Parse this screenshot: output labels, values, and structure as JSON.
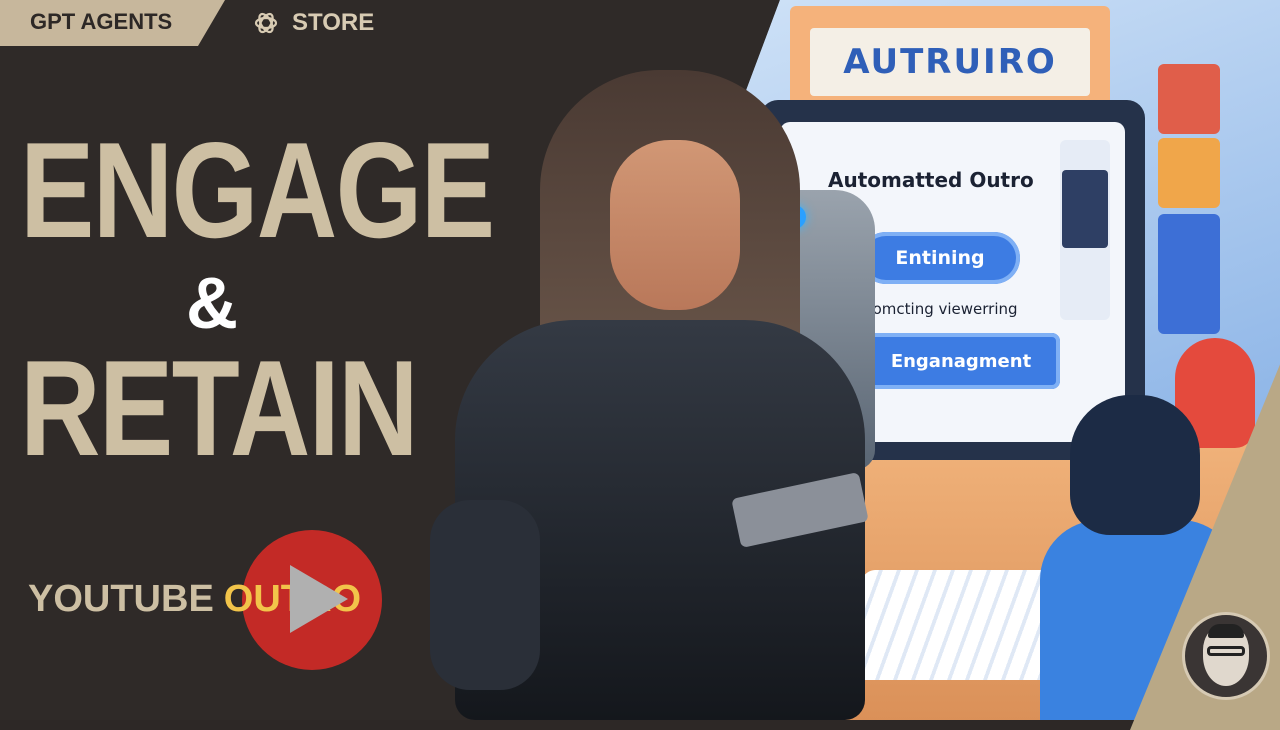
{
  "header": {
    "gpt_agents_label": "GPT AGENTS",
    "store_label": "STORE",
    "store_icon": "openai-logo-icon"
  },
  "headline": {
    "line1": "ENGAGE",
    "amp": "&",
    "line2": "RETAIN"
  },
  "tagline": {
    "word1": "YOUTUBE",
    "word2": "OUTRO",
    "play_icon": "play-icon"
  },
  "illustration": {
    "sign_text": "AUTRUIRO",
    "screen_title": "Automatted Outro",
    "screen_button1": "Entining",
    "screen_text": "Promcting viewerring",
    "screen_button2": "Enganagment"
  },
  "colors": {
    "background": "#2f2a28",
    "accent": "#cdbfa3",
    "highlight": "#f2c44a",
    "youtube_red": "#c32a26"
  }
}
